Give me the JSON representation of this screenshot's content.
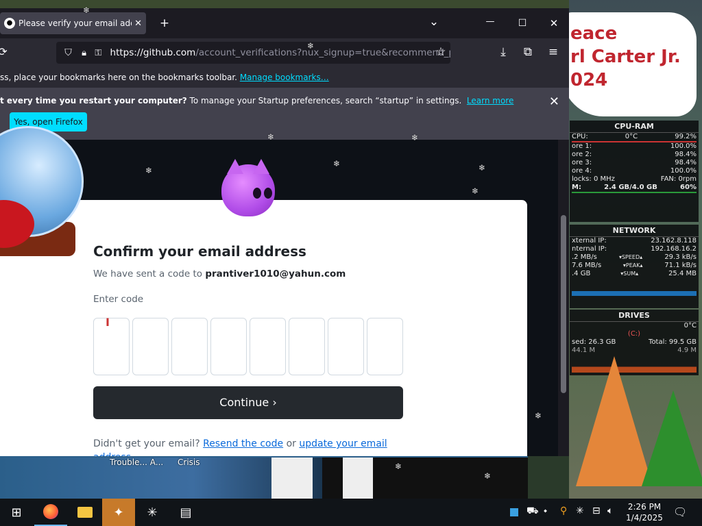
{
  "browser": {
    "tab_title": "Please verify your email address",
    "tab_close": "✕",
    "new_tab": "+",
    "list_tabs": "⌄",
    "minimize": "—",
    "maximize": "☐",
    "close": "✕",
    "url_host": "https://github.com",
    "url_rest": "/account_verifications?nux_signup=true&recommend_p",
    "bookmarks_text": "ss, place your bookmarks here on the bookmarks toolbar.",
    "bookmarks_link": "Manage bookmarks…",
    "notif_bold": "t every time you restart your computer?",
    "notif_text": " To manage your Startup preferences, search “startup” in settings.",
    "notif_link": "Learn more",
    "notif_button": "Yes, open Firefox",
    "notif_close": "✕"
  },
  "page": {
    "heading": "Confirm your email address",
    "sent_text": "We have sent a code to",
    "email": "prantiver1010@yahun.com",
    "code_label": "Enter code",
    "code_boxes": [
      "",
      "",
      "",
      "",
      "",
      "",
      "",
      ""
    ],
    "continue_label": "Continue ›",
    "didnt_get": "Didn't get your email?",
    "resend_link": "Resend the code",
    "or": "or",
    "update_link": "update your email address"
  },
  "desktop": {
    "banner_lines": [
      "eace",
      "rl Carter Jr.",
      "024"
    ],
    "labels": [
      "Trouble... A...",
      "Crisis"
    ]
  },
  "widgets": {
    "cpu": {
      "title": "CPU-RAM",
      "rows": [
        [
          "CPU:",
          "0°C",
          "99.2%"
        ],
        [
          "ore 1:",
          "",
          "100.0%"
        ],
        [
          "ore 2:",
          "",
          "98.4%"
        ],
        [
          "ore 3:",
          "",
          "98.4%"
        ],
        [
          "ore 4:",
          "",
          "100.0%"
        ],
        [
          "locks: 0 MHz",
          "",
          "FAN: 0rpm"
        ],
        [
          "M:",
          "2.4 GB/4.0 GB",
          "60%"
        ]
      ]
    },
    "network": {
      "title": "NETWORK",
      "rows": [
        [
          "xternal IP:",
          "",
          "23.162.8.118"
        ],
        [
          "nternal IP:",
          "",
          "192.168.16.2"
        ],
        [
          ".2 MB/s",
          "▾SPEED▴",
          "29.3 kB/s"
        ],
        [
          "7.6 MB/s",
          "▾PEAK▴",
          "71.1 kB/s"
        ],
        [
          ".4 GB",
          "▾SUM▴",
          "25.4 MB"
        ]
      ]
    },
    "drives": {
      "title": "DRIVES",
      "rows": [
        [
          "",
          "",
          "0°C"
        ],
        [
          "",
          "(C:)",
          ""
        ],
        [
          "sed: 26.3 GB",
          "",
          "Total: 99.5 GB"
        ],
        [
          "44.1 M",
          "",
          "4.9 M"
        ]
      ]
    }
  },
  "taskbar": {
    "time": "2:26 PM",
    "date": "1/4/2025",
    "icons": [
      "windows-start-icon",
      "firefox-icon",
      "file-explorer-icon",
      "app-icon",
      "snowflake-app-icon",
      "control-panel-icon"
    ]
  },
  "colors": {
    "accent_cyan": "#00ddff",
    "github_button": "#25292e",
    "link_blue": "#0969da",
    "firefox_chrome": "#2b2a33"
  }
}
